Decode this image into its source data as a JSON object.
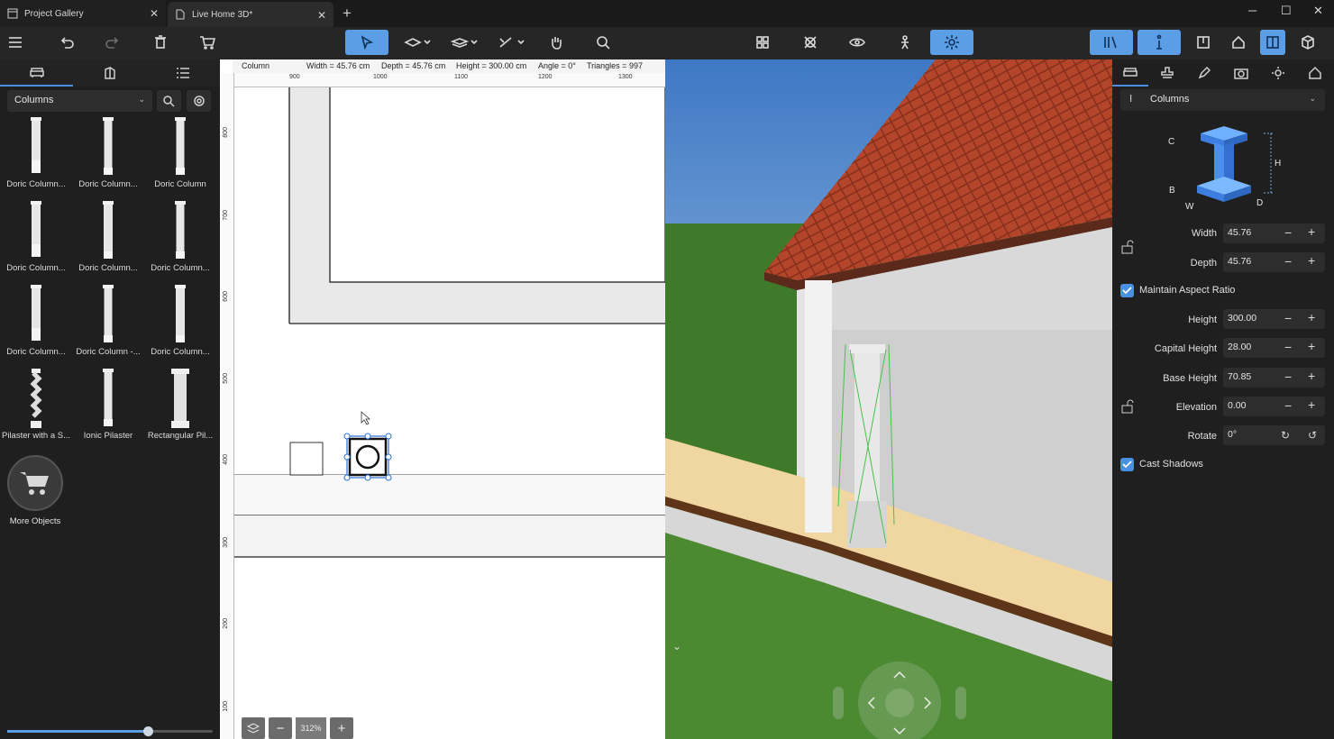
{
  "tabs": [
    {
      "label": "Project Gallery"
    },
    {
      "label": "Live Home 3D*"
    }
  ],
  "colors": {
    "accent": "#5b9ee6",
    "column_blue": "#3d7fe0",
    "selection": "#2b6fd6"
  },
  "left_panel": {
    "category": "Columns",
    "objects": [
      {
        "label": "Doric Column..."
      },
      {
        "label": "Doric Column..."
      },
      {
        "label": "Doric Column"
      },
      {
        "label": "Doric Column..."
      },
      {
        "label": "Doric Column..."
      },
      {
        "label": "Doric Column..."
      },
      {
        "label": "Doric Column..."
      },
      {
        "label": "Doric Column -..."
      },
      {
        "label": "Doric Column..."
      },
      {
        "label": "Pilaster with a S..."
      },
      {
        "label": "Ionic Pilaster"
      },
      {
        "label": "Rectangular Pil..."
      }
    ],
    "more_objects": "More Objects",
    "slider_value": 0.7
  },
  "plan": {
    "info": {
      "object": "Column",
      "width": "Width = 45.76 cm",
      "depth": "Depth = 45.76 cm",
      "height": "Height = 300.00 cm",
      "angle": "Angle = 0°",
      "triangles": "Triangles = 997"
    },
    "ruler_unit": "cm",
    "ruler_top": [
      "900",
      "1000",
      "1100",
      "1200",
      "1300"
    ],
    "ruler_left": [
      "800",
      "700",
      "600",
      "500",
      "400",
      "300",
      "200",
      "100"
    ],
    "zoom": "312%"
  },
  "right_panel": {
    "category": "Columns",
    "diagram_labels": {
      "c": "C",
      "h": "H",
      "b": "B",
      "w": "W",
      "d": "D"
    },
    "props": [
      {
        "label": "Width",
        "value": "45.76"
      },
      {
        "label": "Depth",
        "value": "45.76"
      },
      {
        "label": "Height",
        "value": "300.00"
      },
      {
        "label": "Capital Height",
        "value": "28.00"
      },
      {
        "label": "Base Height",
        "value": "70.85"
      },
      {
        "label": "Elevation",
        "value": "0.00"
      },
      {
        "label": "Rotate",
        "value": "0°"
      }
    ],
    "maintain_aspect": "Maintain Aspect Ratio",
    "cast_shadows": "Cast Shadows"
  }
}
